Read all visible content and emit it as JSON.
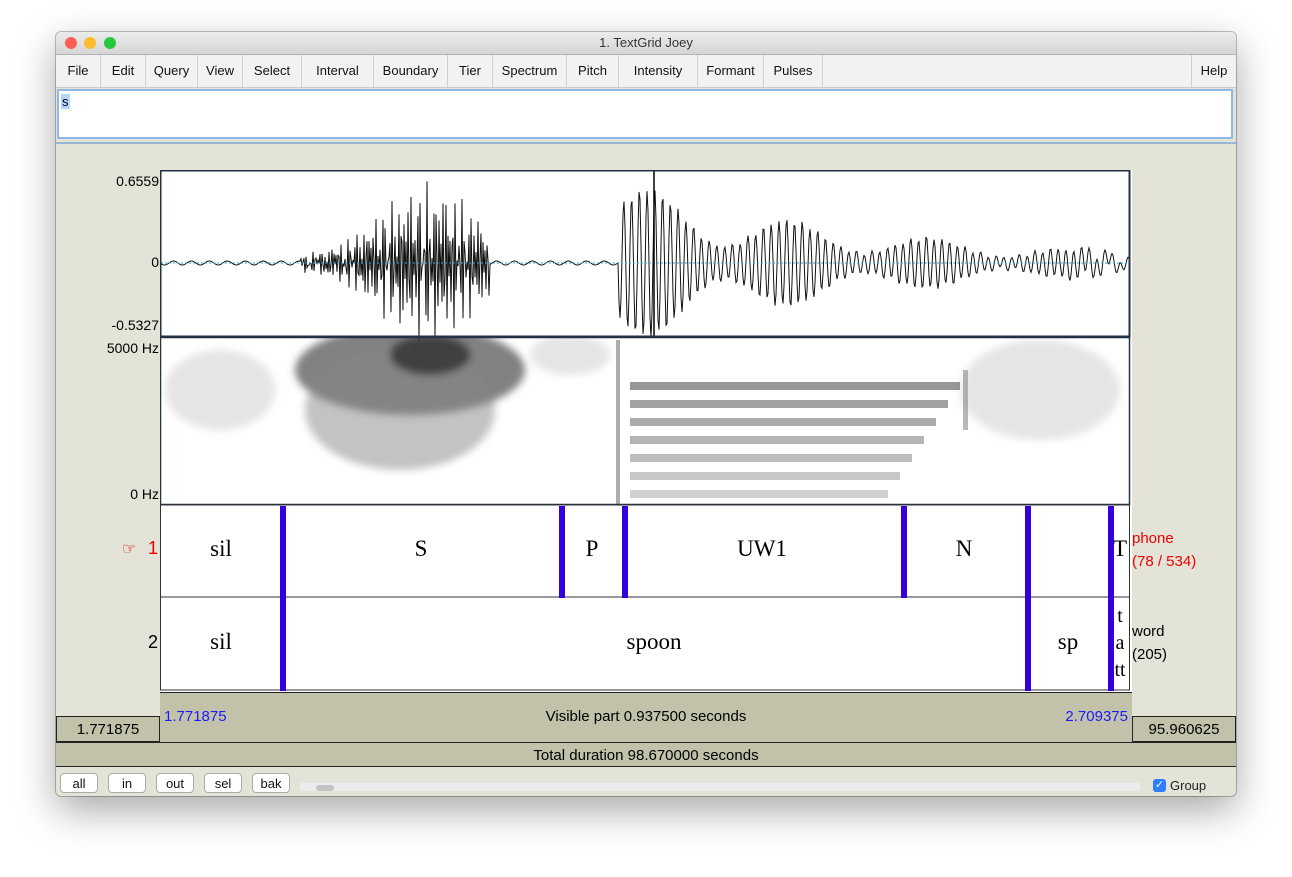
{
  "window": {
    "title": "1. TextGrid Joey"
  },
  "menu": [
    "File",
    "Edit",
    "Query",
    "View",
    "Select",
    "Interval",
    "Boundary",
    "Tier",
    "Spectrum",
    "Pitch",
    "Intensity",
    "Formant",
    "Pulses"
  ],
  "help_label": "Help",
  "text_field": {
    "value": "s"
  },
  "waveform": {
    "max_label": "0.6559",
    "zero_label": "0",
    "min_label": "-0.5327"
  },
  "spectrogram": {
    "top_label": "5000 Hz",
    "bottom_label": "0 Hz"
  },
  "tiers": [
    {
      "number": "1",
      "selected_marker": "☞",
      "name": "phone",
      "count": "(78 / 534)",
      "intervals": [
        "sil",
        "S",
        "P",
        "UW1",
        "N",
        "T"
      ]
    },
    {
      "number": "2",
      "name": "word",
      "count": "(205)",
      "intervals": [
        "sil",
        "spoon",
        "sp"
      ],
      "narrow_interval_lines": [
        "t",
        "a",
        "tt"
      ]
    }
  ],
  "time": {
    "visible_start": "1.771875",
    "visible_end": "2.709375",
    "visible_part": "Visible part 0.937500 seconds",
    "left_outside": "1.771875",
    "right_outside": "95.960625",
    "total_duration": "Total duration 98.670000 seconds"
  },
  "buttons": [
    "all",
    "in",
    "out",
    "sel",
    "bak"
  ],
  "group": {
    "label": "Group",
    "checked": true
  },
  "colors": {
    "boundary": "#3300dd",
    "selected_tier": "#ee0000",
    "time_blue": "#1a1aff",
    "bar_bg": "#c2c2aa"
  }
}
